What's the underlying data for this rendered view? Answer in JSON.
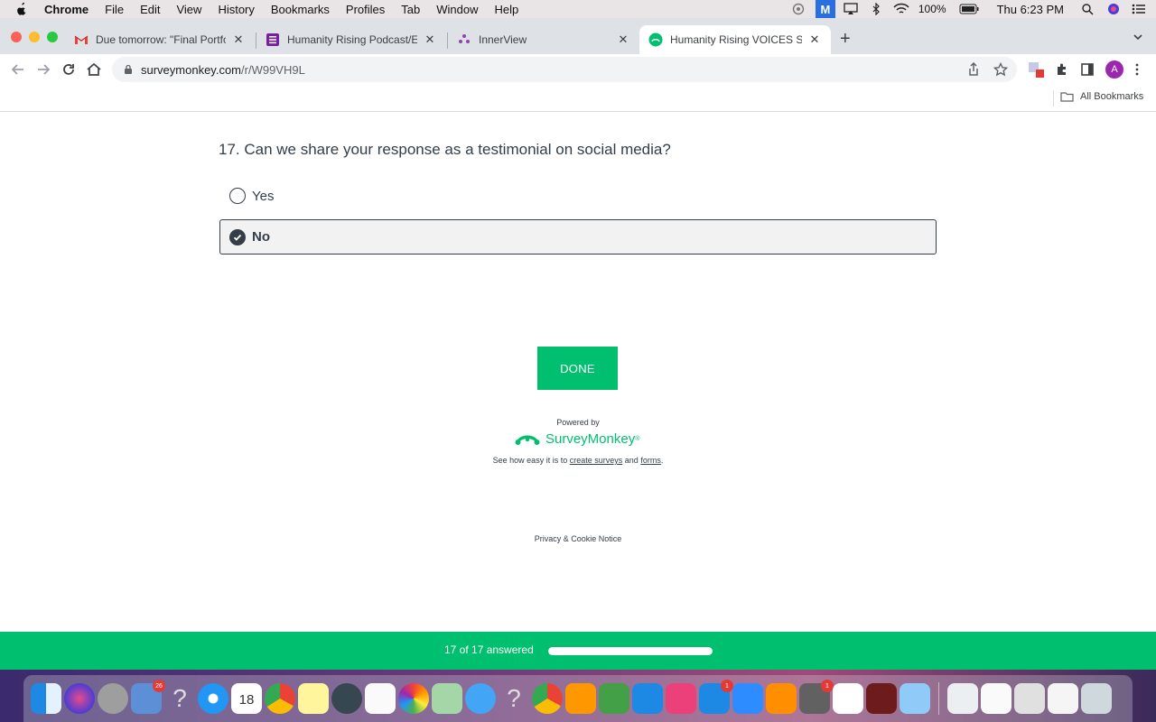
{
  "menubar": {
    "app_name": "Chrome",
    "items": [
      "File",
      "Edit",
      "View",
      "History",
      "Bookmarks",
      "Profiles",
      "Tab",
      "Window",
      "Help"
    ],
    "mail_badge": "M",
    "battery": "100%",
    "clock": "Thu 6:23 PM"
  },
  "tabs": [
    {
      "title": "Due tomorrow: \"Final Portfolio",
      "favicon": "gmail-icon"
    },
    {
      "title": "Humanity Rising Podcast/Event",
      "favicon": "forms-icon"
    },
    {
      "title": "InnerView",
      "favicon": "innerview-icon"
    },
    {
      "title": "Humanity Rising VOICES Surve",
      "favicon": "surveymonkey-icon",
      "active": true
    }
  ],
  "addressbar": {
    "url_host": "surveymonkey.com",
    "url_path": "/r/W99VH9L",
    "profile_initial": "A"
  },
  "bookmarks": {
    "all_label": "All Bookmarks"
  },
  "survey": {
    "question": "17. Can we share your response as a testimonial on social media?",
    "options": [
      {
        "label": "Yes",
        "selected": false
      },
      {
        "label": "No",
        "selected": true
      }
    ],
    "done_label": "DONE",
    "powered_by": "Powered by",
    "brand_name": "SurveyMonkey",
    "brand_mark": "®",
    "see_how_prefix": "See how easy it is to",
    "link_surveys": "create surveys",
    "and_text": "and",
    "link_forms": "forms",
    "period": ".",
    "privacy": "Privacy & Cookie Notice"
  },
  "progress": {
    "label": "17 of 17 answered",
    "fraction": 1.0
  },
  "dock": {
    "badges": {
      "mail": "26",
      "calendar_day": "18",
      "appstore": "1",
      "prefs": "1"
    }
  },
  "colors": {
    "brand_green": "#00bf6f",
    "text_dark": "#333e48"
  }
}
